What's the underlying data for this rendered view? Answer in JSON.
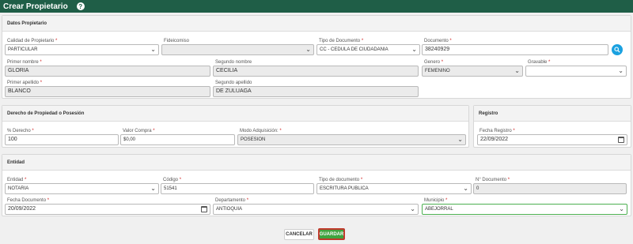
{
  "window": {
    "title": "Crear Propietario"
  },
  "datos_propietario": {
    "header": "Datos Propietario",
    "calidad": {
      "label": "Calidad de Propietario",
      "value": "PARTICULAR"
    },
    "fideicomiso": {
      "label": "Fideicomiso",
      "value": ""
    },
    "tipo_documento": {
      "label": "Tipo de Documento",
      "value": "CC - CEDULA DE CIUDADANIA"
    },
    "documento": {
      "label": "Documento",
      "value": "38240929"
    },
    "primer_nombre": {
      "label": "Primer nombre",
      "value": "GLORIA"
    },
    "segundo_nombre": {
      "label": "Segundo nombre",
      "value": "CECILIA"
    },
    "genero": {
      "label": "Genero",
      "value": "FEMENINO"
    },
    "gravable": {
      "label": "Gravable",
      "value": ""
    },
    "primer_apellido": {
      "label": "Primer apellido",
      "value": "BLANCO"
    },
    "segundo_apellido": {
      "label": "Segundo apellido",
      "value": "DE ZULUAGA"
    }
  },
  "derecho": {
    "header": "Derecho de Propiedad o Posesión",
    "porcentaje": {
      "label": "% Derecho",
      "value": "100"
    },
    "valor_compra": {
      "label": "Valor Compra",
      "value": "$0,00"
    },
    "modo_adquisicion": {
      "label": "Modo Adquisición:",
      "value": "POSESION"
    }
  },
  "registro": {
    "header": "Registro",
    "fecha_registro": {
      "label": "Fecha Registro",
      "value": "22/09/2022"
    }
  },
  "entidad": {
    "header": "Entidad",
    "entidad": {
      "label": "Entidad",
      "value": "NOTARIA"
    },
    "codigo": {
      "label": "Código",
      "value": "51541"
    },
    "tipo_documento": {
      "label": "Tipo de documento",
      "value": "ESCRITURA PUBLICA"
    },
    "numero_documento": {
      "label": "N° Documento",
      "value": "0"
    },
    "fecha_documento": {
      "label": "Fecha Documento",
      "value": "20/09/2022"
    },
    "departamento": {
      "label": "Departamento",
      "value": "ANTIOQUIA"
    },
    "municipio": {
      "label": "Municipio",
      "value": "ABEJORRAL"
    }
  },
  "actions": {
    "cancel": "CANCELAR",
    "save": "GUARDAR"
  },
  "required_mark": "*",
  "colors": {
    "titlebar": "#1f5e47",
    "save": "#3fa33f",
    "search": "#1aa1e0",
    "required": "#d02020"
  }
}
